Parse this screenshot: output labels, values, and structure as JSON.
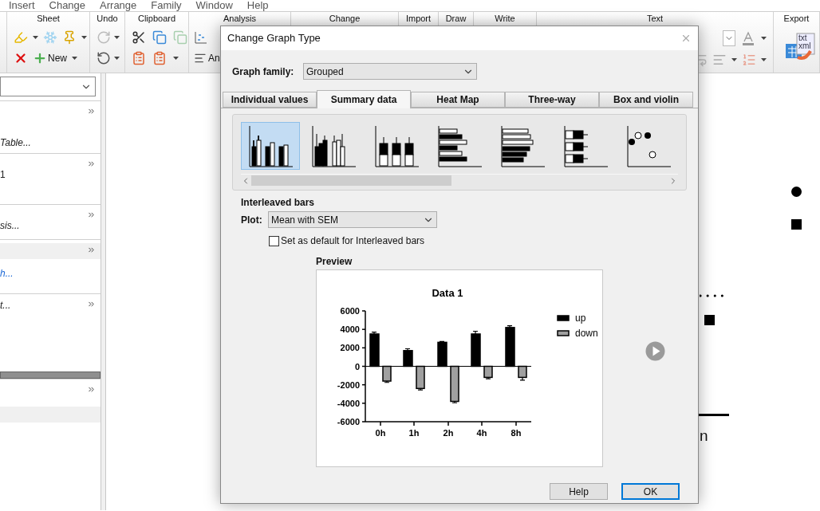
{
  "menu": [
    "Insert",
    "Change",
    "Arrange",
    "Family",
    "Window",
    "Help"
  ],
  "ribbon_groups": [
    {
      "label": "Sheet"
    },
    {
      "label": "Undo"
    },
    {
      "label": "Clipboard"
    },
    {
      "label": "Analysis"
    },
    {
      "label": "Change"
    },
    {
      "label": "Import"
    },
    {
      "label": "Draw"
    },
    {
      "label": "Write"
    },
    {
      "label": "Text"
    },
    {
      "label": "Export"
    }
  ],
  "ribbon": {
    "new_label": "New",
    "analyze_label": "An",
    "export_file_types": [
      "txt",
      "xml"
    ]
  },
  "left_panel": {
    "sections": [
      {
        "items": [
          {
            "kind": "italic",
            "text": "Table..."
          }
        ]
      },
      {
        "items": [
          {
            "kind": "plain",
            "text": "1"
          }
        ]
      },
      {
        "items": [
          {
            "kind": "italic",
            "text": "sis..."
          }
        ]
      },
      {
        "items": [
          {
            "kind": "shaded"
          },
          {
            "kind": "link",
            "text": "h..."
          }
        ]
      },
      {
        "items": [
          {
            "kind": "italic",
            "text": "t..."
          }
        ]
      },
      {
        "items": [
          {
            "kind": "shaded"
          }
        ]
      }
    ]
  },
  "canvas": {
    "text": "n"
  },
  "dialog": {
    "title": "Change Graph Type",
    "graph_family_label": "Graph family:",
    "graph_family": "Grouped",
    "tabs": [
      {
        "label": "Individual values",
        "selected": false
      },
      {
        "label": "Summary data",
        "selected": true
      },
      {
        "label": "Heat Map",
        "selected": false
      },
      {
        "label": "Three-way",
        "selected": false
      },
      {
        "label": "Box and violin",
        "selected": false
      }
    ],
    "thumbnails": [
      {
        "kind": "interleaved",
        "selected": true
      },
      {
        "kind": "grouped",
        "selected": false
      },
      {
        "kind": "stacked",
        "selected": false
      },
      {
        "kind": "hinterleaved",
        "selected": false
      },
      {
        "kind": "hgrouped",
        "selected": false
      },
      {
        "kind": "hstacked",
        "selected": false
      },
      {
        "kind": "dots",
        "selected": false
      }
    ],
    "section_title": "Interleaved bars",
    "plot_label": "Plot:",
    "plot": "Mean with SEM",
    "default_checkbox": {
      "label": "Set as default for Interleaved bars",
      "checked": false
    },
    "preview_label": "Preview",
    "preview": {
      "chart_data": {
        "type": "bar",
        "title": "Data 1",
        "legend": "right",
        "categories": [
          "0h",
          "1h",
          "2h",
          "4h",
          "8h"
        ],
        "series": [
          {
            "name": "up",
            "color": "#000000",
            "values": [
              3500,
              1700,
              2600,
              3500,
              4200
            ]
          },
          {
            "name": "down",
            "color": "#a0a0a0",
            "values": [
              -1600,
              -2400,
              -3800,
              -1200,
              -1200
            ]
          }
        ],
        "ylim": [
          -6000,
          6000
        ],
        "yticks": [
          -6000,
          -4000,
          -2000,
          0,
          2000,
          4000,
          6000
        ]
      }
    },
    "buttons": [
      {
        "kind": "plain",
        "label": "Help"
      },
      {
        "kind": "default",
        "label": "OK"
      }
    ]
  }
}
